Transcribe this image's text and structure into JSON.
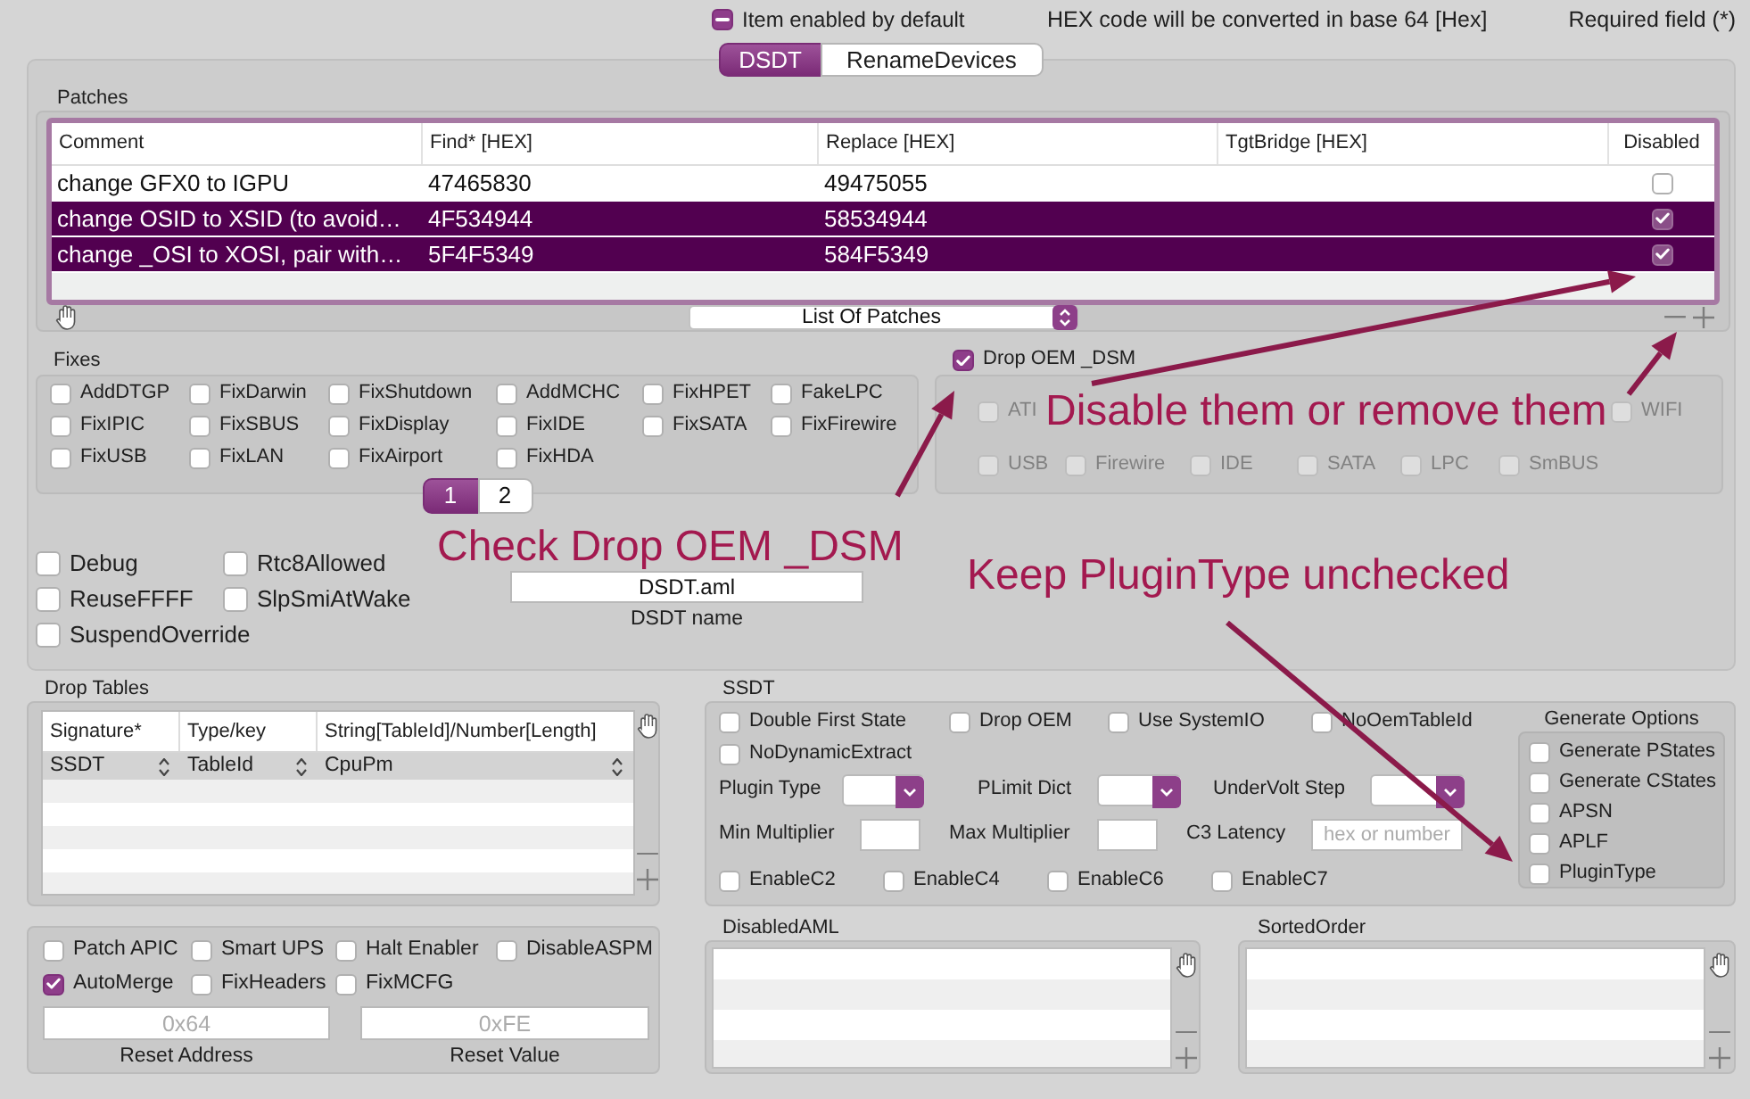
{
  "header": {
    "default_toggle": {
      "label": "Item enabled by default",
      "checked": true,
      "indeterminate": true
    },
    "notes": [
      "HEX code will be converted in base 64 [Hex]",
      "Required field (*)"
    ]
  },
  "tabs": [
    {
      "label": "DSDT",
      "selected": true
    },
    {
      "label": "RenameDevices",
      "selected": false
    }
  ],
  "patches": {
    "title": "Patches",
    "columns": [
      "Comment",
      "Find* [HEX]",
      "Replace [HEX]",
      "TgtBridge [HEX]",
      "Disabled"
    ],
    "rows": [
      {
        "comment": "change GFX0 to IGPU",
        "find": "47465830",
        "replace": "49475055",
        "disabled": false,
        "selected": false
      },
      {
        "comment": "change OSID to XSID (to avoid…",
        "find": "4F534944",
        "replace": "58534944",
        "disabled": true,
        "selected": true
      },
      {
        "comment": "change _OSI to XOSI, pair with…",
        "find": "5F4F5349",
        "replace": "584F5349",
        "disabled": true,
        "selected": true
      }
    ],
    "list_selector": "List Of Patches"
  },
  "fixes": {
    "title": "Fixes",
    "items": [
      {
        "label": "AddDTGP",
        "checked": false
      },
      {
        "label": "FixDarwin",
        "checked": false
      },
      {
        "label": "FixShutdown",
        "checked": false
      },
      {
        "label": "AddMCHC",
        "checked": false
      },
      {
        "label": "FixHPET",
        "checked": false
      },
      {
        "label": "FakeLPC",
        "checked": false
      },
      {
        "label": "FixIPIC",
        "checked": false
      },
      {
        "label": "FixSBUS",
        "checked": false
      },
      {
        "label": "FixDisplay",
        "checked": false
      },
      {
        "label": "FixIDE",
        "checked": false
      },
      {
        "label": "FixSATA",
        "checked": false
      },
      {
        "label": "FixFirewire",
        "checked": false
      },
      {
        "label": "FixUSB",
        "checked": false
      },
      {
        "label": "FixLAN",
        "checked": false
      },
      {
        "label": "FixAirport",
        "checked": false
      },
      {
        "label": "FixHDA",
        "checked": false
      }
    ],
    "pages": [
      {
        "label": "1",
        "selected": true
      },
      {
        "label": "2",
        "selected": false
      }
    ]
  },
  "drop_oem_dsm": {
    "label": "Drop OEM _DSM",
    "checked": true,
    "devices": {
      "disabled": true,
      "rows": [
        [
          {
            "label": "ATI",
            "checked": false
          },
          {
            "label": "WIFI",
            "checked": false
          }
        ],
        [
          {
            "label": "USB",
            "checked": false
          },
          {
            "label": "Firewire",
            "checked": false
          },
          {
            "label": "IDE",
            "checked": false
          },
          {
            "label": "SATA",
            "checked": false
          },
          {
            "label": "LPC",
            "checked": false
          },
          {
            "label": "SmBUS",
            "checked": false
          }
        ]
      ]
    }
  },
  "flags": [
    {
      "label": "Debug",
      "checked": false
    },
    {
      "label": "Rtc8Allowed",
      "checked": false
    },
    {
      "label": "ReuseFFFF",
      "checked": false
    },
    {
      "label": "SlpSmiAtWake",
      "checked": false
    },
    {
      "label": "SuspendOverride",
      "checked": false
    }
  ],
  "dsdt_name": {
    "value": "DSDT.aml",
    "label": "DSDT name"
  },
  "annotations": [
    {
      "text": "Disable them or remove them"
    },
    {
      "text": "Check Drop OEM _DSM"
    },
    {
      "text": "Keep PluginType unchecked"
    }
  ],
  "drop_tables": {
    "title": "Drop Tables",
    "columns": [
      "Signature*",
      "Type/key",
      "String[TableId]/Number[Length]"
    ],
    "rows": [
      {
        "signature": "SSDT",
        "type_key": "TableId",
        "value": "CpuPm",
        "selected": true
      }
    ]
  },
  "ssdt": {
    "title": "SSDT",
    "options": [
      {
        "label": "Double First State",
        "checked": false
      },
      {
        "label": "Drop OEM",
        "checked": false
      },
      {
        "label": "Use SystemIO",
        "checked": false
      },
      {
        "label": "NoOemTableId",
        "checked": false
      },
      {
        "label": "NoDynamicExtract",
        "checked": false
      }
    ],
    "dropdowns": [
      {
        "label": "Plugin Type"
      },
      {
        "label": "PLimit Dict"
      },
      {
        "label": "UnderVolt Step"
      }
    ],
    "fields": [
      {
        "label": "Min Multiplier"
      },
      {
        "label": "Max Multiplier"
      },
      {
        "label": "C3 Latency",
        "placeholder": "hex or number"
      }
    ],
    "c_states": [
      {
        "label": "EnableC2",
        "checked": false
      },
      {
        "label": "EnableC4",
        "checked": false
      },
      {
        "label": "EnableC6",
        "checked": false
      },
      {
        "label": "EnableC7",
        "checked": false
      }
    ],
    "generate_options": {
      "title": "Generate Options",
      "items": [
        {
          "label": "Generate PStates",
          "checked": false
        },
        {
          "label": "Generate CStates",
          "checked": false
        },
        {
          "label": "APSN",
          "checked": false
        },
        {
          "label": "APLF",
          "checked": false
        },
        {
          "label": "PluginType",
          "checked": false
        }
      ]
    }
  },
  "reset_options": {
    "options": [
      {
        "label": "Patch APIC",
        "checked": false
      },
      {
        "label": "Smart UPS",
        "checked": false
      },
      {
        "label": "Halt Enabler",
        "checked": false
      },
      {
        "label": "DisableASPM",
        "checked": false
      },
      {
        "label": "AutoMerge",
        "checked": true
      },
      {
        "label": "FixHeaders",
        "checked": false
      },
      {
        "label": "FixMCFG",
        "checked": false
      }
    ],
    "fields": [
      {
        "placeholder": "0x64",
        "label": "Reset Address"
      },
      {
        "placeholder": "0xFE",
        "label": "Reset Value"
      }
    ]
  },
  "disabled_aml": {
    "title": "DisabledAML"
  },
  "sorted_order": {
    "title": "SortedOrder"
  }
}
